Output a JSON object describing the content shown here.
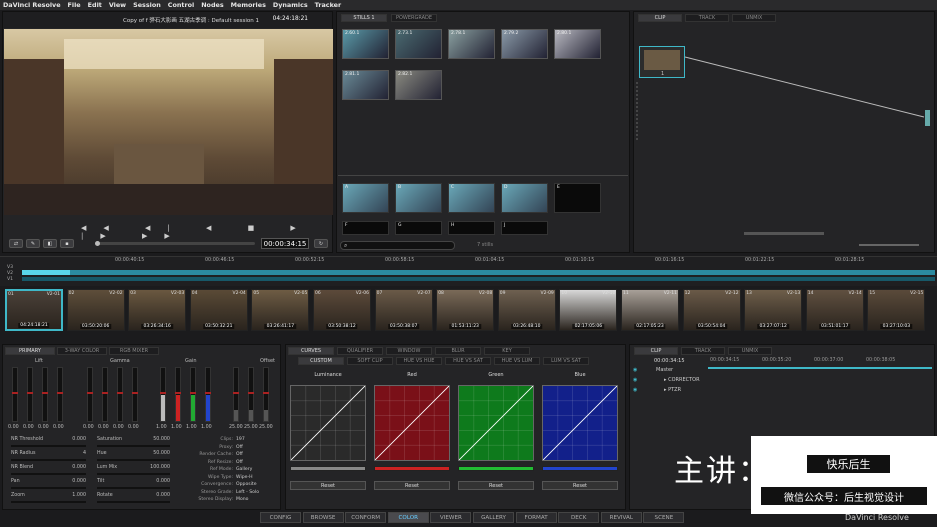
{
  "menu": [
    "DaVinci Resolve",
    "File",
    "Edit",
    "View",
    "Session",
    "Control",
    "Nodes",
    "Memories",
    "Dynamics",
    "Tracker"
  ],
  "viewer": {
    "title": "Copy of f 骅石大影画 五湖古季调 : Default session 1",
    "timecode_top": "04:24:18:21",
    "timecode": "00:00:34:15"
  },
  "gallery": {
    "tabs": [
      "STILLS 1",
      "POWERGRADE"
    ],
    "stills": [
      "2.60.1",
      "2.73.1",
      "2.78.1",
      "2.79.2",
      "2.80.1",
      "2.81.1",
      "2.82.1"
    ],
    "memory_slots": [
      "A",
      "B",
      "C",
      "D",
      "E",
      "F",
      "G",
      "H",
      "J"
    ],
    "count": "7 stills"
  },
  "node": {
    "tabs": [
      "CLIP",
      "TRACK",
      "UNMIX"
    ],
    "node_label": "1"
  },
  "timeline": {
    "tracks": [
      "V3",
      "V2",
      "V1"
    ],
    "ruler": [
      "00:00:40:15",
      "00:00:46:15",
      "00:00:52:15",
      "00:00:58:15",
      "00:01:04:15",
      "00:01:10:15",
      "00:01:16:15",
      "00:01:22:15",
      "00:01:28:15"
    ],
    "ruler_first": "00:00:34:15"
  },
  "clips": [
    {
      "num": "01",
      "vid": "V2-01",
      "tc": "04:24:18:21"
    },
    {
      "num": "02",
      "vid": "V2-02",
      "tc": "03:50:20:06"
    },
    {
      "num": "03",
      "vid": "V2-03",
      "tc": "03:26:34:16"
    },
    {
      "num": "04",
      "vid": "V2-04",
      "tc": "03:50:32:21"
    },
    {
      "num": "05",
      "vid": "V2-05",
      "tc": "03:26:41:17"
    },
    {
      "num": "06",
      "vid": "V2-06",
      "tc": "03:50:38:12"
    },
    {
      "num": "07",
      "vid": "V2-07",
      "tc": "03:50:38:07"
    },
    {
      "num": "08",
      "vid": "V2-08",
      "tc": "01:53:11:23"
    },
    {
      "num": "09",
      "vid": "V2-09",
      "tc": "03:26:48:10"
    },
    {
      "num": "10",
      "vid": "V2-10",
      "tc": "02:17:05:06"
    },
    {
      "num": "11",
      "vid": "V2-11",
      "tc": "02:17:05:23"
    },
    {
      "num": "12",
      "vid": "V2-12",
      "tc": "03:50:54:04"
    },
    {
      "num": "13",
      "vid": "V2-13",
      "tc": "03:27:07:12"
    },
    {
      "num": "14",
      "vid": "V2-14",
      "tc": "03:51:01:17"
    },
    {
      "num": "15",
      "vid": "V2-15",
      "tc": "03:27:10:03"
    }
  ],
  "primary": {
    "tabs": [
      "PRIMARY",
      "3-WAY COLOR",
      "RGB MIXER"
    ],
    "wheels": [
      "Lift",
      "Gamma",
      "Gain",
      "Offset"
    ],
    "lift_values": [
      "0.00",
      "0.00",
      "0.00",
      "0.00"
    ],
    "gamma_values": [
      "0.00",
      "0.00",
      "0.00",
      "0.00"
    ],
    "gain_values": [
      "1.00",
      "1.00",
      "1.00",
      "1.00"
    ],
    "offset_values": [
      "25.00",
      "25.00",
      "25.00"
    ],
    "params_left": [
      [
        "NR Threshold",
        "0.000"
      ],
      [
        "NR Radius",
        "4"
      ],
      [
        "NR Blend",
        "0.000"
      ],
      [
        "Pan",
        "0.000"
      ],
      [
        "Zoom",
        "1.000"
      ]
    ],
    "params_mid": [
      [
        "Saturation",
        "50.000"
      ],
      [
        "Hue",
        "50.000"
      ],
      [
        "Lum Mix",
        "100.000"
      ],
      [
        "Tilt",
        "0.000"
      ],
      [
        "Rotate",
        "0.000"
      ]
    ],
    "info": [
      [
        "Clips",
        "197"
      ],
      [
        "Proxy",
        "Off"
      ],
      [
        "Render Cache",
        "Off"
      ],
      [
        "Ref Resize",
        "Off"
      ],
      [
        "Ref Mode",
        "Gallery"
      ],
      [
        "Wipe Type",
        "Wipe-H"
      ],
      [
        "Convergence",
        "Opposite"
      ],
      [
        "Stereo Grade",
        "Left - Solo"
      ],
      [
        "Stereo Display",
        "Mono"
      ]
    ]
  },
  "curves": {
    "tabs": [
      "CURVES",
      "QUALIFIER",
      "WINDOW",
      "BLUR",
      "KEY"
    ],
    "subtabs": [
      "CUSTOM",
      "SOFT CLIP",
      "HUE VS HUE",
      "HUE VS SAT",
      "HUE VS LUM",
      "LUM VS SAT"
    ],
    "channels": [
      {
        "name": "Luminance",
        "color": "#888888",
        "bg": "#2a2a2a"
      },
      {
        "name": "Red",
        "color": "#cc2222",
        "bg": "#7a1018"
      },
      {
        "name": "Green",
        "color": "#22bb33",
        "bg": "#0e7a1c"
      },
      {
        "name": "Blue",
        "color": "#2244cc",
        "bg": "#12208a"
      }
    ],
    "reset": "Reset"
  },
  "keyframe": {
    "tabs": [
      "CLIP",
      "TRACK",
      "UNMIX"
    ],
    "timecode": "00:00:34:15",
    "ruler": [
      "00:00:34:15",
      "00:00:35:20",
      "00:00:37:00",
      "00:00:38:05"
    ],
    "rows": [
      "Master",
      "CORRECTOR",
      "PTZR"
    ]
  },
  "watermark": {
    "title": "主讲：张溢杰",
    "badge": "快乐后生",
    "wechat": "微信公众号：后生视觉设计"
  },
  "pages": [
    "CONFIG",
    "BROWSE",
    "CONFORM",
    "COLOR",
    "VIEWER",
    "GALLERY",
    "FORMAT",
    "DECK",
    "REVIVAL",
    "SCENE"
  ],
  "active_page": "COLOR",
  "brand": "DaVinci Resolve",
  "accent": "#3fb8c8"
}
